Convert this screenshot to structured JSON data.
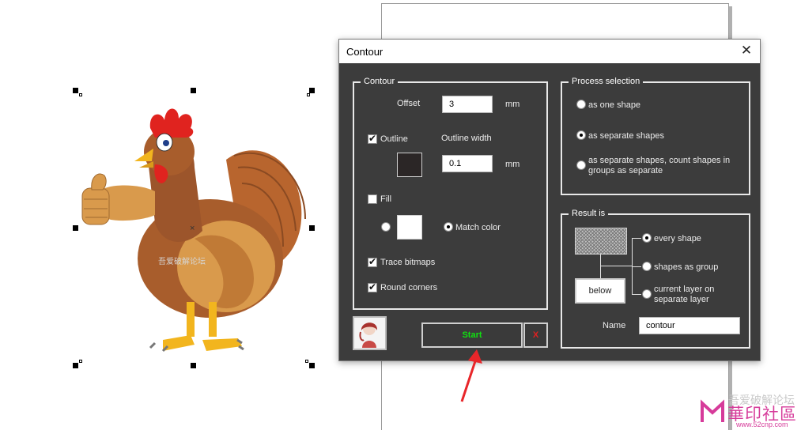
{
  "dialog": {
    "title": "Contour",
    "close_label": "✕",
    "contour_group": {
      "legend": "Contour",
      "offset_label": "Offset",
      "offset_value": "3",
      "offset_unit": "mm",
      "outline_label": "Outline",
      "outline_checked": true,
      "outline_width_label": "Outline width",
      "outline_width_value": "0.1",
      "outline_width_unit": "mm",
      "outline_color": "#2b2626",
      "fill_label": "Fill",
      "fill_checked": false,
      "fill_color": "#ffffff",
      "match_color_label": "Match color",
      "match_color_selected": true,
      "trace_bitmaps_label": "Trace bitmaps",
      "trace_bitmaps_checked": true,
      "round_corners_label": "Round corners",
      "round_corners_checked": true
    },
    "process_group": {
      "legend": "Process selection",
      "options": [
        {
          "label": "as one shape",
          "selected": false
        },
        {
          "label": "as separate shapes",
          "selected": true
        },
        {
          "label": "as separate shapes, count shapes in groups as separate",
          "selected": false
        }
      ]
    },
    "result_group": {
      "legend": "Result is",
      "below_label": "below",
      "options": [
        {
          "label": "every shape",
          "selected": true
        },
        {
          "label": "shapes as group",
          "selected": false
        },
        {
          "label": "current layer on separate layer",
          "selected": false
        }
      ],
      "name_label": "Name",
      "name_value": "contour"
    },
    "start_label": "Start",
    "cancel_label": "X"
  },
  "watermark": {
    "line1": "吾爱破解论坛",
    "brand": "華印社區",
    "url": "www.52cnp.com"
  },
  "artwork_watermark": "吾爱破解论坛"
}
